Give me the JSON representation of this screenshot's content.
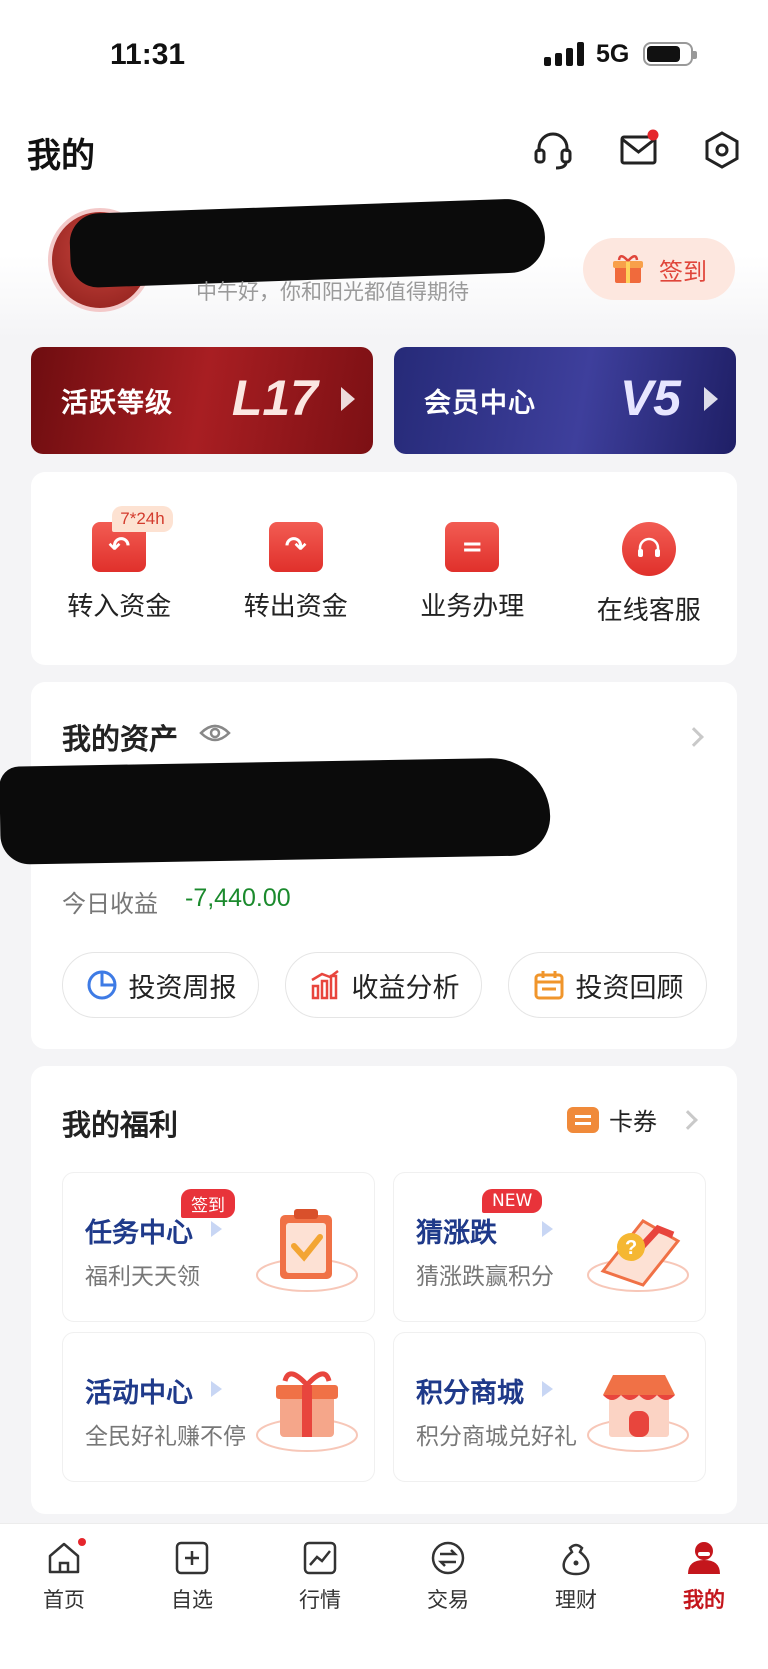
{
  "status_bar": {
    "time": "11:31",
    "network": "5G"
  },
  "header": {
    "title": "我的"
  },
  "profile": {
    "greeting": "中午好，你和阳光都值得期待",
    "signin_label": "签到"
  },
  "level_cards": [
    {
      "label": "活跃等级",
      "value": "L17"
    },
    {
      "label": "会员中心",
      "value": "V5"
    }
  ],
  "quick_actions": {
    "badge": "7*24h",
    "items": [
      {
        "label": "转入资金",
        "icon": "transfer-in-icon"
      },
      {
        "label": "转出资金",
        "icon": "transfer-out-icon"
      },
      {
        "label": "业务办理",
        "icon": "business-icon"
      },
      {
        "label": "在线客服",
        "icon": "online-service-icon"
      }
    ]
  },
  "assets": {
    "title": "我的资产",
    "today_label": "今日收益",
    "today_value": "-7,440.00",
    "buttons": [
      {
        "label": "投资周报",
        "icon": "pie-chart-icon"
      },
      {
        "label": "收益分析",
        "icon": "bar-chart-icon"
      },
      {
        "label": "投资回顾",
        "icon": "calendar-icon"
      }
    ]
  },
  "welfare": {
    "title": "我的福利",
    "coupon_label": "卡券",
    "cards": [
      {
        "title": "任务中心",
        "subtitle": "福利天天领",
        "tag": "签到"
      },
      {
        "title": "猜涨跌",
        "subtitle": "猜涨跌赢积分",
        "tag": "NEW"
      },
      {
        "title": "活动中心",
        "subtitle": "全民好礼赚不停",
        "tag": ""
      },
      {
        "title": "积分商城",
        "subtitle": "积分商城兑好礼",
        "tag": ""
      }
    ]
  },
  "tabbar": {
    "items": [
      {
        "label": "首页"
      },
      {
        "label": "自选"
      },
      {
        "label": "行情"
      },
      {
        "label": "交易"
      },
      {
        "label": "理财"
      },
      {
        "label": "我的"
      }
    ],
    "active": "我的"
  },
  "colors": {
    "accent": "#c4161c",
    "negative": "#1b8a2d",
    "title_blue": "#1f3a8a"
  }
}
